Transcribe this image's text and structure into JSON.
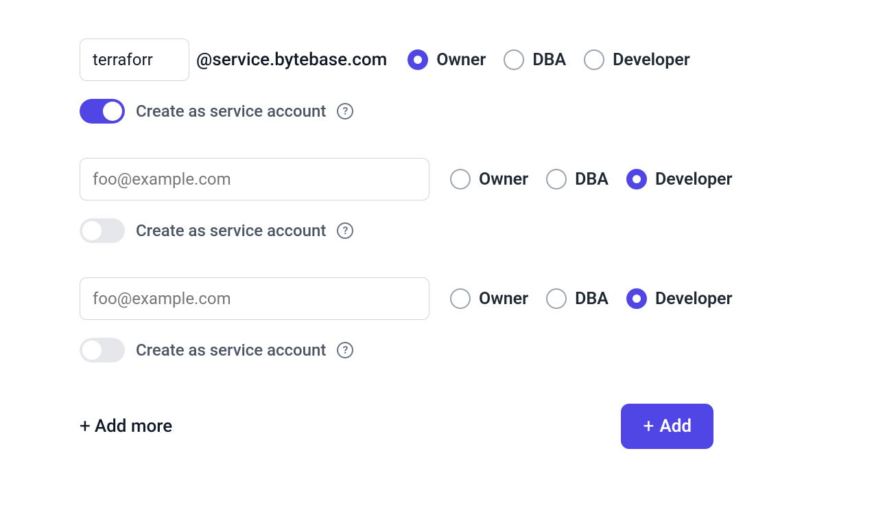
{
  "roles": {
    "owner": "Owner",
    "dba": "DBA",
    "developer": "Developer"
  },
  "shared": {
    "service_account_label": "Create as service account",
    "email_placeholder": "foo@example.com",
    "domain_suffix": "@service.bytebase.com"
  },
  "entries": [
    {
      "email_value": "terraforr",
      "is_service": true,
      "role": "owner"
    },
    {
      "email_value": "",
      "is_service": false,
      "role": "developer"
    },
    {
      "email_value": "",
      "is_service": false,
      "role": "developer"
    }
  ],
  "footer": {
    "add_more_label": "Add more",
    "add_button_label": "Add"
  }
}
